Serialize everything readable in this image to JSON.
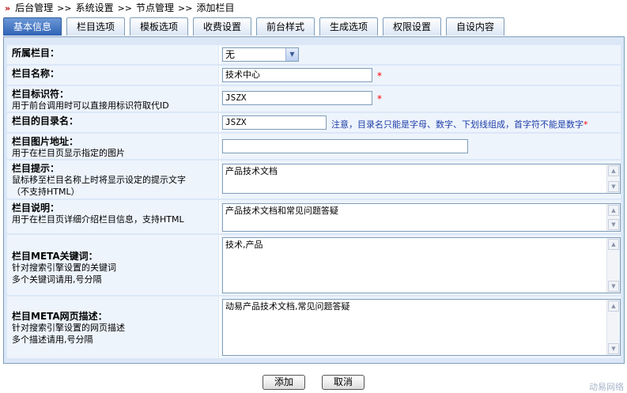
{
  "breadcrumb": {
    "items": [
      "后台管理",
      "系统设置",
      "节点管理",
      "添加栏目"
    ],
    "separator": ">>"
  },
  "tabs": [
    "基本信息",
    "栏目选项",
    "模板选项",
    "收费设置",
    "前台样式",
    "生成选项",
    "权限设置",
    "自设内容"
  ],
  "form": {
    "parent": {
      "label": "所属栏目：",
      "value": "无"
    },
    "name": {
      "label": "栏目名称：",
      "value": "技术中心",
      "required": "*"
    },
    "identifier": {
      "label": "栏目标识符：",
      "hint": "用于前台调用时可以直接用标识符取代ID",
      "value": "JSZX",
      "required": "*"
    },
    "dir": {
      "label": "栏目的目录名：",
      "value": "JSZX",
      "note": "注意，目录名只能是字母、数字、下划线组成，首字符不能是数字",
      "required": "*"
    },
    "image": {
      "label": "栏目图片地址：",
      "hint": "用于在栏目页显示指定的图片",
      "value": ""
    },
    "tip": {
      "label": "栏目提示：",
      "hint1": "鼠标移至栏目名称上时将显示设定的提示文字",
      "hint2": "（不支持HTML）",
      "value": "产品技术文档"
    },
    "desc": {
      "label": "栏目说明：",
      "hint": "用于在栏目页详细介绍栏目信息，支持HTML",
      "value": "产品技术文档和常见问题答疑"
    },
    "keywords": {
      "label": "栏目META关键词：",
      "hint1": "针对搜索引擎设置的关键词",
      "hint2": "多个关键词请用,号分隔",
      "value": "技术,产品"
    },
    "meta_desc": {
      "label": "栏目META网页描述：",
      "hint1": "针对搜索引擎设置的网页描述",
      "hint2": "多个描述请用,号分隔",
      "value": "动易产品技术文档,常见问题答疑"
    }
  },
  "buttons": {
    "add": "添加",
    "cancel": "取消"
  },
  "watermark": "动易网络",
  "colors": {
    "active_tab": "#3a6fc0",
    "required": "#ff0000",
    "note": "#1f3ea8"
  }
}
